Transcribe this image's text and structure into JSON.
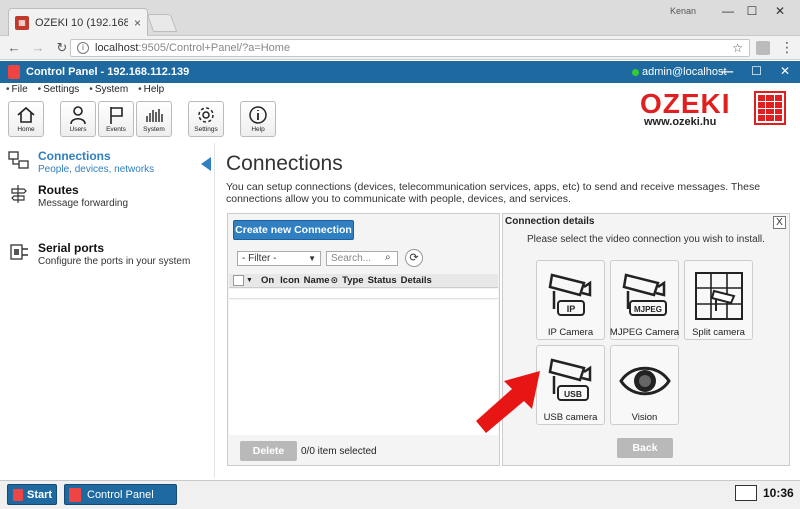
{
  "browser": {
    "tab_title": "OZEKI 10 (192.168.112.13",
    "tab_close": "×",
    "profile_name": "Kenan",
    "url": "localhost:9505/Control+Panel/?a=Home",
    "url_host": "localhost",
    "url_rest": ":9505/Control+Panel/?a=Home"
  },
  "app": {
    "title": "Control Panel - 192.168.112.139",
    "user": "admin@localhost"
  },
  "menu": [
    "File",
    "Settings",
    "System",
    "Help"
  ],
  "toolbar": {
    "home": "Home",
    "users": "Users",
    "events": "Events",
    "system": "System",
    "settings": "Settings",
    "help": "Help"
  },
  "logo": {
    "text": "OZEKI",
    "url": "www.ozeki.hu"
  },
  "sidebar": {
    "items": [
      {
        "title": "Connections",
        "subtitle": "People, devices, networks",
        "active": true,
        "icon": "connections-icon"
      },
      {
        "title": "Routes",
        "subtitle": "Message forwarding",
        "active": false,
        "icon": "routes-icon"
      },
      {
        "title": "Serial ports",
        "subtitle": "Configure the ports in your system",
        "active": false,
        "icon": "serial-ports-icon"
      }
    ]
  },
  "main": {
    "title": "Connections",
    "description": "You can setup connections (devices, telecommunication services, apps, etc) to send and receive messages. These connections allow you to communicate with people, devices, and services."
  },
  "connections_panel": {
    "create_button": "Create new Connection",
    "filter_value": "- Filter -",
    "search_placeholder": "Search...",
    "columns": [
      "On",
      "Icon",
      "Name",
      "Type",
      "Status",
      "Details"
    ],
    "delete_button": "Delete",
    "selection_status": "0/0 item selected"
  },
  "details_panel": {
    "title": "Connection details",
    "close": "X",
    "message": "Please select the video connection you wish to install.",
    "tiles": [
      {
        "label": "IP Camera",
        "badge": "IP"
      },
      {
        "label": "MJPEG Camera",
        "badge": "MJPEG"
      },
      {
        "label": "Split camera",
        "badge": ""
      },
      {
        "label": "USB camera",
        "badge": "USB"
      },
      {
        "label": "Vision",
        "badge": ""
      }
    ],
    "back_button": "Back"
  },
  "taskbar": {
    "start": "Start",
    "task": "Control Panel",
    "clock": "10:36"
  },
  "colors": {
    "accent": "#1e6aa0",
    "link": "#2f7fc1",
    "brand_red": "#e02020",
    "arrow_red": "#e81515"
  }
}
